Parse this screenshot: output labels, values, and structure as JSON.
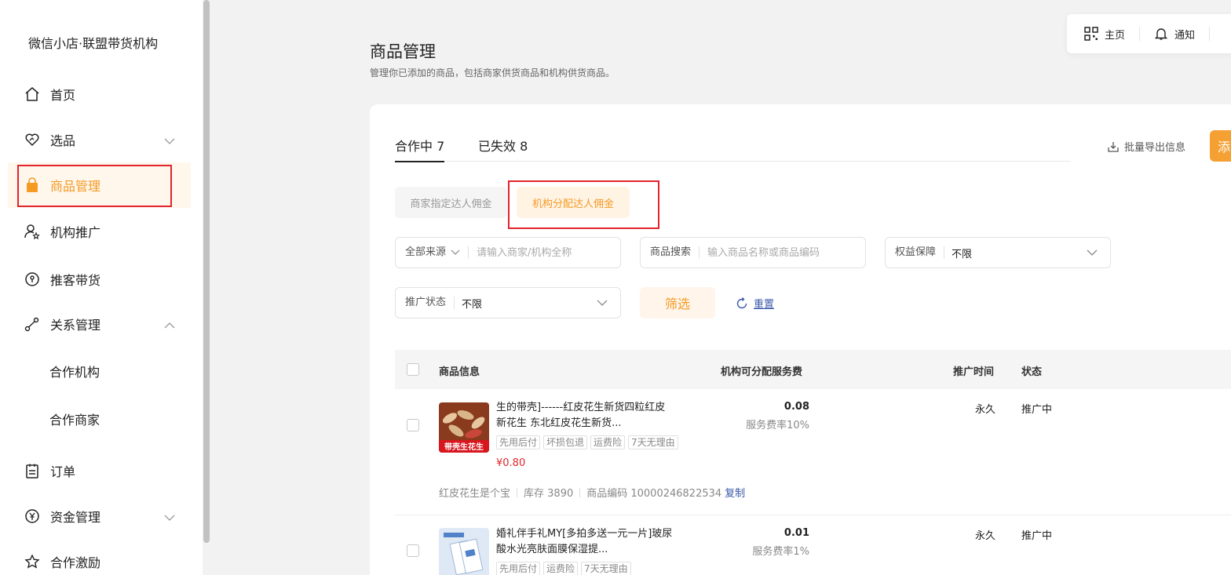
{
  "sidebar": {
    "brand": "微信小店·联盟带货机构",
    "items": [
      {
        "label": "首页"
      },
      {
        "label": "选品"
      },
      {
        "label": "商品管理"
      },
      {
        "label": "机构推广"
      },
      {
        "label": "推客带货"
      },
      {
        "label": "关系管理"
      },
      {
        "label": "合作机构"
      },
      {
        "label": "合作商家"
      },
      {
        "label": "订单"
      },
      {
        "label": "资金管理"
      },
      {
        "label": "合作激励"
      }
    ]
  },
  "topbar": {
    "home": "主页",
    "notice": "通知"
  },
  "page": {
    "title": "商品管理",
    "subtitle": "管理你已添加的商品，包括商家供货商品和机构供货商品。"
  },
  "tabs": [
    {
      "label": "合作中 7"
    },
    {
      "label": "已失效 8"
    }
  ],
  "actions": {
    "export": "批量导出信息",
    "add": "添"
  },
  "segments": [
    {
      "label": "商家指定达人佣金"
    },
    {
      "label": "机构分配达人佣金"
    }
  ],
  "filters": {
    "source": {
      "label": "全部来源",
      "placeholder": "请输入商家/机构全称"
    },
    "search": {
      "label": "商品搜索",
      "placeholder": "输入商品名称或商品编码"
    },
    "rights": {
      "label": "权益保障",
      "value": "不限"
    },
    "status": {
      "label": "推广状态",
      "value": "不限"
    },
    "filter_btn": "筛选",
    "reset_btn": "重置"
  },
  "table": {
    "headers": {
      "info": "商品信息",
      "fee": "机构可分配服务费",
      "time": "推广时间",
      "status": "状态"
    },
    "rows": [
      {
        "name": "生的带壳]------红皮花生新货四粒红皮新花生 东北红皮花生新货...",
        "thumb_label": "带壳生花生",
        "tags": [
          "先用后付",
          "坏损包退",
          "运费险",
          "7天无理由"
        ],
        "price": "¥0.80",
        "fee": "0.08",
        "rate": "服务费率10%",
        "time": "永久",
        "status": "推广中",
        "shop": "红皮花生是个宝",
        "stock": "库存 3890",
        "code": "商品编码 10000246822534",
        "copy": "复制"
      },
      {
        "name": "婚礼伴手礼MY[多拍多送一元一片]玻尿酸水光亮肤面膜保湿提...",
        "tags": [
          "先用后付",
          "运费险",
          "7天无理由"
        ],
        "fee": "0.01",
        "rate": "服务费率1%",
        "time": "永久",
        "status": "推广中"
      }
    ]
  },
  "colors": {
    "accent": "#f59a23",
    "highlight": "#e2242c",
    "price": "#e0282e",
    "link": "#3a5aa8"
  }
}
